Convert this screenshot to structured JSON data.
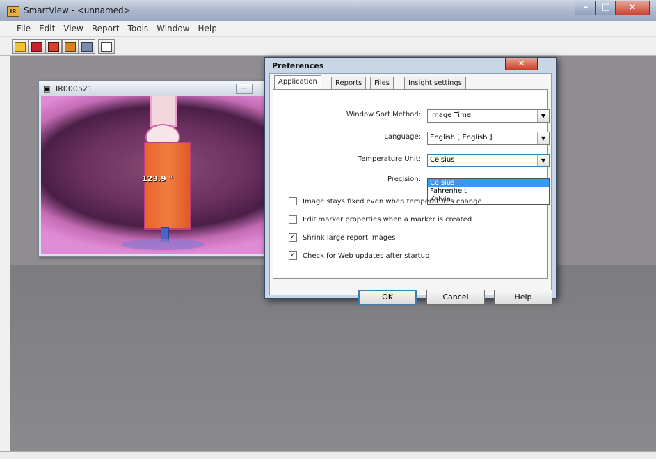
{
  "window": {
    "title": "SmartView - <unnamed>",
    "app_icon": "IR"
  },
  "window_controls": {
    "minimize": "–",
    "maximize": "□",
    "close": "×"
  },
  "menu": [
    "File",
    "Edit",
    "View",
    "Report",
    "Tools",
    "Window",
    "Help"
  ],
  "toolbar": {
    "icons": [
      "open-icon",
      "save-icon",
      "images-icon",
      "report-edit-icon",
      "settings-tool-icon",
      "print-icon"
    ]
  },
  "image_window": {
    "title": "IR000521",
    "temperature": "123.9 °"
  },
  "preferences": {
    "title": "Preferences",
    "close": "×",
    "tabs": [
      "Application",
      "Reports",
      "Files",
      "Insight settings"
    ],
    "window_sort": {
      "label": "Window Sort Method:",
      "value": "Image Time"
    },
    "language": {
      "label": "Language:",
      "value": "English [ English ]"
    },
    "temperature_unit": {
      "label": "Temperature Unit:",
      "value": "Celsius",
      "options": [
        "Celsius",
        "Fahrenheit",
        "Kelvin"
      ],
      "selected_option": "Celsius"
    },
    "precision": {
      "label": "Precision:"
    },
    "checkboxes": [
      {
        "label": "Image stays fixed even when temperatures change",
        "checked": false
      },
      {
        "label": "Edit marker properties when a marker is created",
        "checked": false
      },
      {
        "label": "Shrink large report images",
        "checked": true
      },
      {
        "label": "Check for Web updates after startup",
        "checked": true
      }
    ],
    "buttons": {
      "ok": "OK",
      "cancel": "Cancel",
      "help": "Help"
    }
  },
  "colors": {
    "dialog_frame": "#c9d6e6",
    "workspace": "#8f8d90",
    "selection": "#3399ff",
    "close_button": "#c6412a"
  }
}
